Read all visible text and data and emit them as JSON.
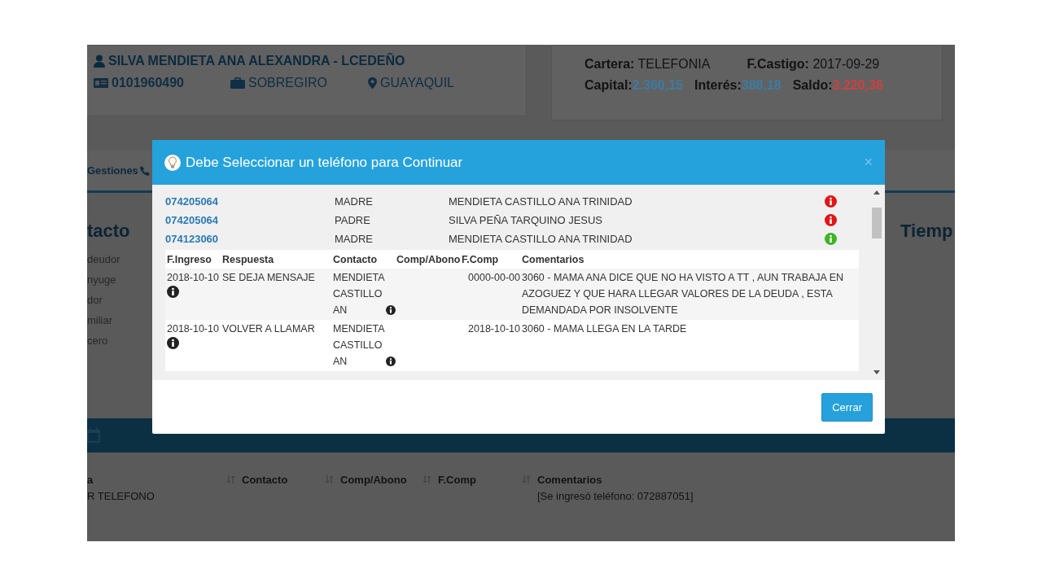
{
  "background": {
    "debtor": {
      "name": "SILVA MENDIETA ANA ALEXANDRA - LCEDEÑO",
      "id": "0101960490",
      "product": "SOBREGIRO",
      "city": "GUAYAQUIL"
    },
    "account": {
      "fields": [
        {
          "label": "Cartera:",
          "value": "TELEFONIA"
        },
        {
          "label": "F.Castigo:",
          "value": "2017-09-29"
        }
      ],
      "amounts": [
        {
          "label": "Capital:",
          "value": "2.360,15",
          "color": "#3d7ca3"
        },
        {
          "label": "Interés:",
          "value": "388,18",
          "color": "#3d7ca3"
        },
        {
          "label": "Saldo:",
          "value": "3.220,36",
          "color": "#d0403f"
        }
      ]
    },
    "tab": "Gestiones",
    "contact_heading": "tacto",
    "contact_items": [
      "deudor",
      "nyuge",
      "dor",
      "miliar",
      "cero"
    ],
    "side_heading": "Tiemp",
    "table": {
      "columns": [
        "a",
        "Contacto",
        "Comp/Abono",
        "F.Comp",
        "Comentarios"
      ],
      "rows": [
        {
          "column_1": "R TELEFONO",
          "comentarios": "[Se ingresó teléfono: 072887051]"
        }
      ]
    }
  },
  "modal": {
    "title": "Debe Seleccionar un teléfono para Continuar",
    "close": "×",
    "phones": [
      {
        "number": "074205064",
        "relation": "MADRE",
        "name": "MENDIETA CASTILLO ANA TRINIDAD",
        "color": "#e31515"
      },
      {
        "number": "074205064",
        "relation": "PADRE",
        "name": "SILVA PEÑA TARQUINO JESUS",
        "color": "#e31515"
      },
      {
        "number": "074123060",
        "relation": "MADRE",
        "name": "MENDIETA CASTILLO ANA TRINIDAD",
        "color": "#3cb521"
      }
    ],
    "history": {
      "columns": [
        "F.Ingreso",
        "Respuesta",
        "Contacto",
        "Comp/Abono",
        "F.Comp",
        "Comentarios"
      ],
      "rows": [
        {
          "f_ingreso": "2018-10-10",
          "respuesta": "SE DEJA MENSAJE",
          "contacto": "MENDIETA CASTILLO AN",
          "f_comp": "0000-00-00",
          "comentarios": "3060 -  MAMA ANA DICE QUE NO HA VISTO A TT , AUN TRABAJA EN AZOGUEZ Y QUE HARA LLEGAR VALORES DE LA DEUDA , ESTA DEMANDADA POR INSOLVENTE"
        },
        {
          "f_ingreso": "2018-10-10",
          "respuesta": "VOLVER A LLAMAR",
          "contacto": "MENDIETA CASTILLO AN",
          "f_comp": "2018-10-10",
          "comentarios": "3060 - MAMA LLEGA EN LA TARDE"
        }
      ]
    },
    "close_button": "Cerrar"
  }
}
